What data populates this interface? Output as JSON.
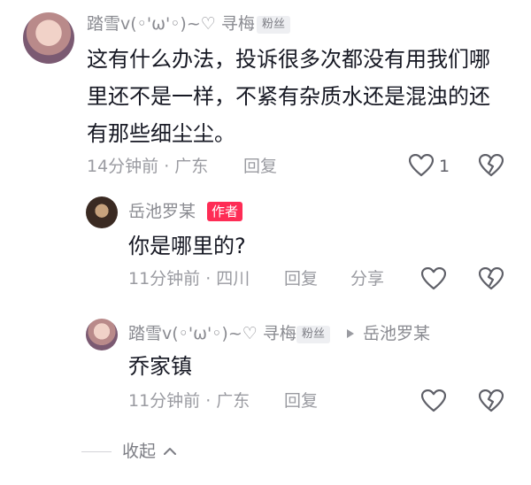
{
  "comments": [
    {
      "user": "踏雪v(◦'ω'◦)~♡ 寻梅",
      "badge": "粉丝",
      "text_lines": [
        "这有什么办法，投诉很多次都没有用我们哪",
        "里还不是一样，不紧有杂质水还是混浊的还",
        "有那些细尘尘。"
      ],
      "time": "14分钟前",
      "dot": "·",
      "location": "广东",
      "reply_label": "回复",
      "like_count": "1"
    }
  ],
  "replies": [
    {
      "user": "岳池罗某",
      "badge": "作者",
      "text": "你是哪里的?",
      "time": "11分钟前",
      "dot": "·",
      "location": "四川",
      "reply_label": "回复",
      "share_label": "分享"
    },
    {
      "user": "踏雪v(◦'ω'◦)~♡ 寻梅",
      "badge": "粉丝",
      "reply_to": "岳池罗某",
      "text": "乔家镇",
      "time": "11分钟前",
      "dot": "·",
      "location": "广东",
      "reply_label": "回复"
    }
  ],
  "collapse_label": "收起",
  "icons": {
    "like": "heart-outline-icon",
    "dislike": "broken-heart-icon",
    "reply_arrow": "triangle-right-icon",
    "collapse": "chevron-up-icon"
  }
}
